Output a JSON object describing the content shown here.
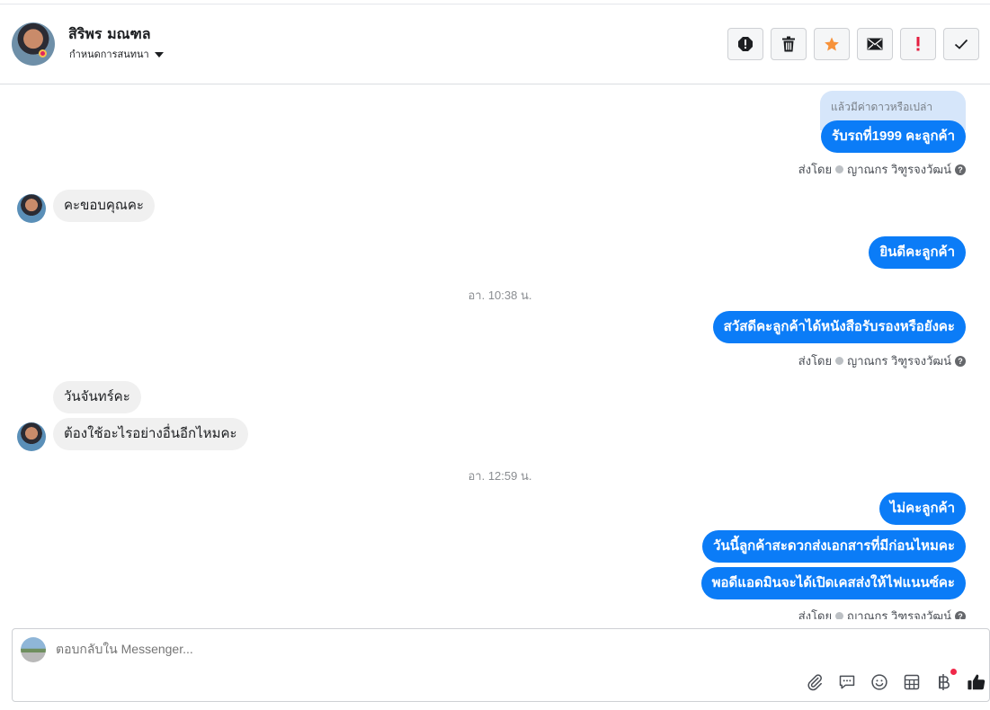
{
  "header": {
    "name": "สิริพร มณฑล",
    "subtitle": "กำหนดการสนทนา",
    "actions": [
      {
        "name": "report-button",
        "icon": "alert-circle-icon"
      },
      {
        "name": "delete-button",
        "icon": "trash-icon"
      },
      {
        "name": "star-button",
        "icon": "star-icon",
        "color": "#f7923a"
      },
      {
        "name": "mark-unread-button",
        "icon": "envelope-icon"
      },
      {
        "name": "spam-button",
        "icon": "exclamation-icon",
        "color": "#e41e3f"
      },
      {
        "name": "done-button",
        "icon": "checkmark-icon"
      }
    ]
  },
  "messages": {
    "reply_reference": "แล้วมีค่าดาวหรือเปล่า",
    "m1": "รับรถที่1999 คะลูกค้า",
    "sent_by_1": "ส่งโดย",
    "agent_1": "ญาณกร วิฑูรจงวัฒน์",
    "m2": "คะขอบคุณคะ",
    "m3": "ยินดีคะลูกค้า",
    "time_1": "อา. 10:38 น.",
    "m4": "สวัสดีคะลูกค้าได้หนังสือรับรองหรือยังคะ",
    "sent_by_2": "ส่งโดย",
    "agent_2": "ญาณกร วิฑูรจงวัฒน์",
    "m5": "วันจันทร์คะ",
    "m6": "ต้องใช้อะไรอย่างอื่นอีกไหมคะ",
    "time_2": "อา. 12:59 น.",
    "m7": "ไม่คะลูกค้า",
    "m8": "วันนี้ลูกค้าสะดวกส่งเอกสารที่มีก่อนไหมคะ",
    "m9": "พอดีแอดมินจะได้เปิดเคสส่งให้ไฟแนนซ์คะ",
    "sent_by_3": "ส่งโดย",
    "agent_3": "ญาณกร วิฑูรจงวัฒน์"
  },
  "composer": {
    "placeholder": "ตอบกลับใน Messenger...",
    "icons": [
      "paperclip-icon",
      "saved-reply-icon",
      "emoji-icon",
      "table-icon",
      "baht-icon",
      "thumbs-up-icon"
    ]
  },
  "colors": {
    "outgoing_bubble": "#0b7cf7",
    "incoming_bubble": "#f0f0f0",
    "reply_reference": "#d6e6fa"
  }
}
